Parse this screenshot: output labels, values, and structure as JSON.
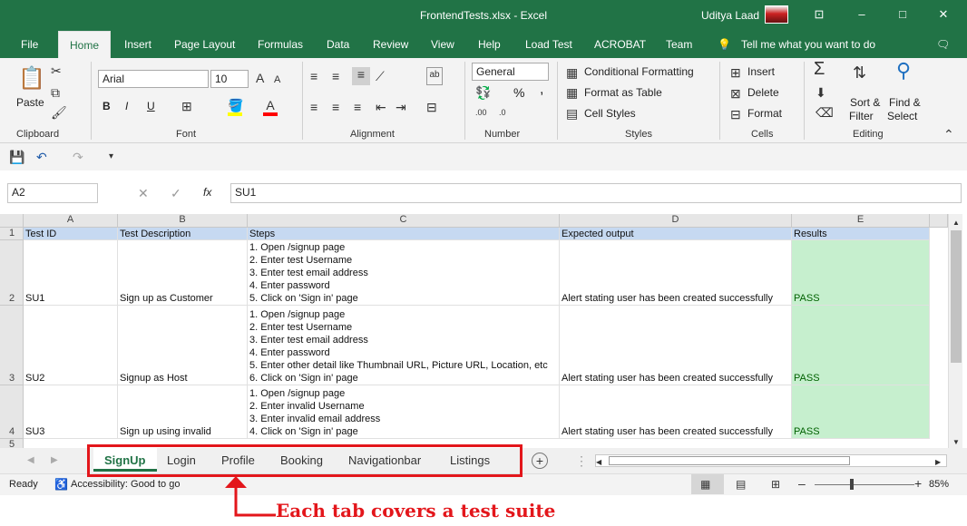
{
  "window": {
    "title": "FrontendTests.xlsx  -  Excel",
    "user": "Uditya Laad"
  },
  "ribbon_tabs": [
    "File",
    "Home",
    "Insert",
    "Page Layout",
    "Formulas",
    "Data",
    "Review",
    "View",
    "Help",
    "Load Test",
    "ACROBAT",
    "Team"
  ],
  "tell_me": "Tell me what you want to do",
  "clipboard": {
    "paste": "Paste",
    "group": "Clipboard"
  },
  "font": {
    "name": "Arial",
    "size": "10",
    "group": "Font",
    "bold": "B",
    "italic": "I",
    "underline": "U"
  },
  "alignment": {
    "group": "Alignment"
  },
  "number": {
    "format": "General",
    "group": "Number",
    "percent": "%",
    "comma": ","
  },
  "styles": {
    "conditional": "Conditional Formatting",
    "table": "Format as Table",
    "cell": "Cell Styles",
    "group": "Styles"
  },
  "cells": {
    "insert": "Insert",
    "delete": "Delete",
    "format": "Format",
    "group": "Cells"
  },
  "editing": {
    "sort1": "Sort &",
    "sort2": "Filter",
    "find1": "Find &",
    "find2": "Select",
    "group": "Editing"
  },
  "formula_bar": {
    "name_box": "A2",
    "fx": "fx",
    "value": "SU1"
  },
  "columns": [
    "A",
    "B",
    "C",
    "D",
    "E"
  ],
  "rows": [
    {
      "num": "1",
      "id": "Test ID",
      "desc": "Test Description",
      "steps": [
        "Steps"
      ],
      "expected": "Expected output",
      "result": "Results"
    },
    {
      "num": "2",
      "id": "SU1",
      "desc": "Sign up as Customer",
      "steps": [
        "1. Open /signup page",
        "2. Enter test Username",
        "3. Enter test email address",
        "4. Enter password",
        "5. Click on 'Sign in' page"
      ],
      "expected": "Alert stating user has been created successfully",
      "result": "PASS"
    },
    {
      "num": "3",
      "id": "SU2",
      "desc": "Signup as Host",
      "steps": [
        "1. Open /signup page",
        "2. Enter test Username",
        "3. Enter test email address",
        "4. Enter password",
        "5. Enter other detail like Thumbnail URL, Picture URL, Location, etc",
        "6. Click on 'Sign in' page"
      ],
      "expected": "Alert stating user has been created successfully",
      "result": "PASS"
    },
    {
      "num": "4",
      "id": "SU3",
      "desc": "Sign up using invalid",
      "steps": [
        "1. Open /signup page",
        "2. Enter invalid Username",
        "3. Enter invalid email address",
        "4. Click on 'Sign in' page"
      ],
      "expected": "Alert stating user has been created successfully",
      "result": "PASS"
    },
    {
      "num": "5"
    }
  ],
  "sheet_tabs": [
    "SignUp",
    "Login",
    "Profile",
    "Booking",
    "Navigationbar",
    "Listings"
  ],
  "status": {
    "ready": "Ready",
    "accessibility": "Accessibility: Good to go",
    "zoom": "85%"
  },
  "annotation": "Each tab covers a test suite",
  "colors": {
    "excel_green": "#217346",
    "header_blue": "#c6d9f1",
    "pass_green": "#c6efce",
    "annotation_red": "#e3161b"
  }
}
